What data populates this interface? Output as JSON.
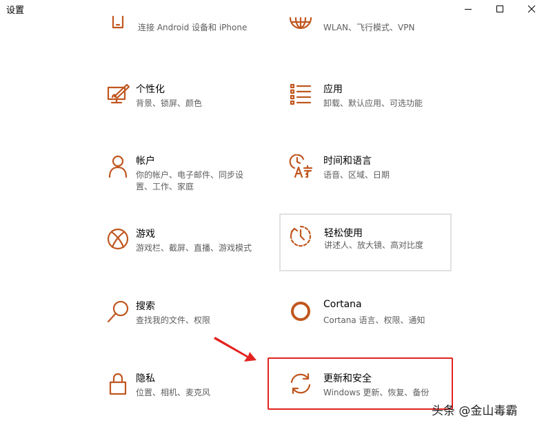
{
  "window": {
    "title": "设置"
  },
  "colors": {
    "accent": "#c0561f",
    "highlight": "#e3221f"
  },
  "tiles": [
    {
      "id": "phone",
      "name": "",
      "desc": "连接 Android 设备和 iPhone",
      "icon": "phone-icon"
    },
    {
      "id": "network",
      "name": "",
      "desc": "WLAN、飞行模式、VPN",
      "icon": "globe-icon"
    },
    {
      "id": "personalization",
      "name": "个性化",
      "desc": "背景、锁屏、颜色",
      "icon": "personalization-icon"
    },
    {
      "id": "apps",
      "name": "应用",
      "desc": "卸载、默认应用、可选功能",
      "icon": "apps-list-icon"
    },
    {
      "id": "accounts",
      "name": "帐户",
      "desc": "你的帐户、电子邮件、同步设置、工作、家庭",
      "icon": "person-icon"
    },
    {
      "id": "time",
      "name": "时间和语言",
      "desc": "语音、区域、日期",
      "icon": "time-language-icon"
    },
    {
      "id": "gaming",
      "name": "游戏",
      "desc": "游戏栏、截屏、直播、游戏模式",
      "icon": "xbox-icon"
    },
    {
      "id": "ease",
      "name": "轻松使用",
      "desc": "讲述人、放大镜、高对比度",
      "icon": "ease-of-access-icon"
    },
    {
      "id": "search",
      "name": "搜索",
      "desc": "查找我的文件、权限",
      "icon": "search-icon"
    },
    {
      "id": "cortana",
      "name": "Cortana",
      "desc": "Cortana 语言、权限、通知",
      "icon": "cortana-ring-icon"
    },
    {
      "id": "privacy",
      "name": "隐私",
      "desc": "位置、相机、麦克风",
      "icon": "lock-icon"
    },
    {
      "id": "update",
      "name": "更新和安全",
      "desc": "Windows 更新、恢复、备份",
      "icon": "sync-arrows-icon"
    }
  ],
  "watermark": "头条 @金山毒霸"
}
